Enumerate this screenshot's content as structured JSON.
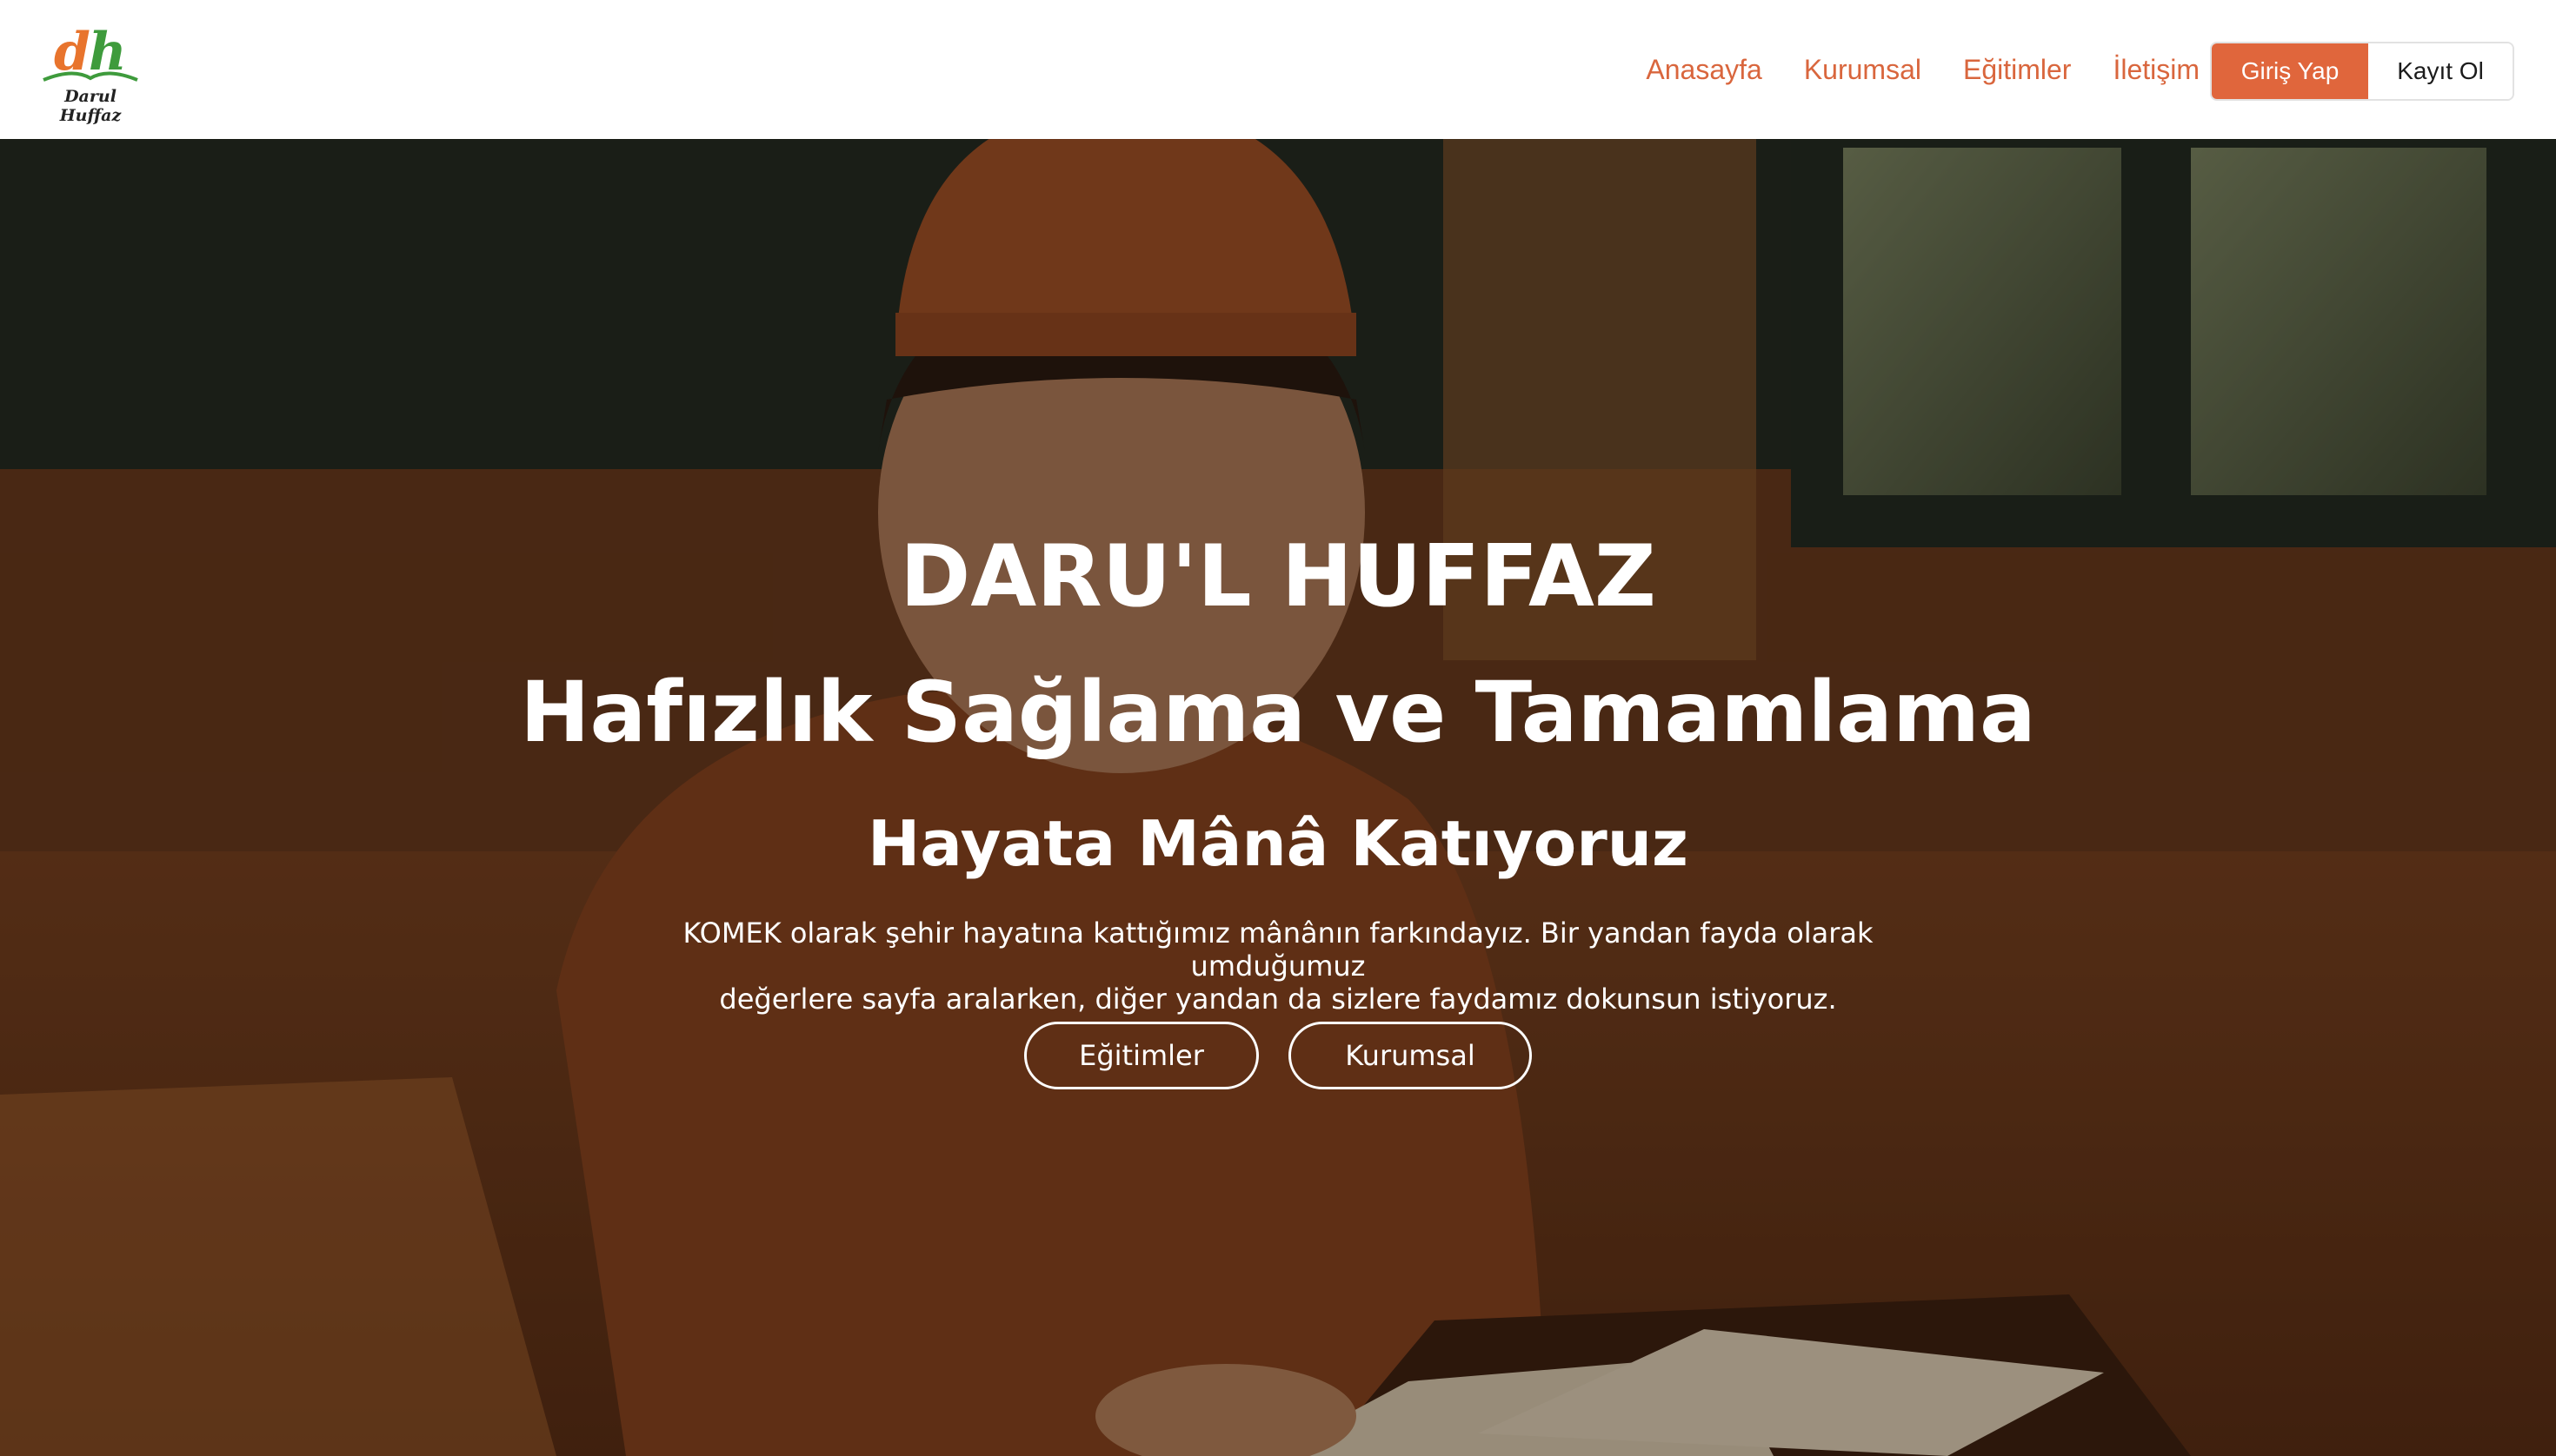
{
  "header": {
    "logo_mark": "dh",
    "logo_text": "Darul Huffaz",
    "nav": [
      "Anasayfa",
      "Kurumsal",
      "Eğitimler",
      "İletişim"
    ],
    "login_label": "Giriş Yap",
    "register_label": "Kayıt Ol"
  },
  "hero": {
    "title": "DARU'L HUFFAZ",
    "subtitle": "Hafızlık Sağlama ve Tamamlama",
    "tagline": "Hayata Mânâ Katıyoruz",
    "description_line1": "KOMEK olarak şehir hayatına kattığımız mânânın farkındayız. Bir yandan fayda olarak umduğumuz",
    "description_line2": "değerlere sayfa aralarken, diğer yandan da sizlere faydamız dokunsun istiyoruz.",
    "buttons": [
      "Eğitimler",
      "Kurumsal"
    ]
  },
  "colors": {
    "accent": "#e0663c",
    "nav_text": "#d9663d",
    "logo_orange": "#e8742d",
    "logo_green": "#3e9b3c"
  }
}
